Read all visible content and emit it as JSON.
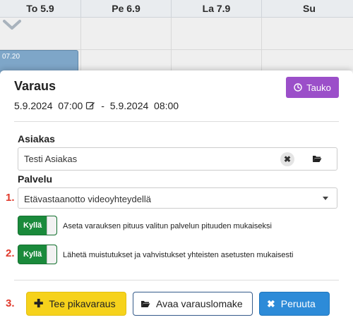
{
  "calendar": {
    "days": [
      "To 5.9",
      "Pe 6.9",
      "La 7.9",
      "Su"
    ],
    "event_time": "07.20"
  },
  "modal": {
    "title": "Varaus",
    "break_button": "Tauko",
    "start": "5.9.2024  07:00",
    "separator": " - ",
    "end": "5.9.2024  08:00",
    "customer_label": "Asiakas",
    "customer_value": "Testi Asiakas",
    "service_label": "Palvelu",
    "service_value": "Etävastaanotto videoyhteydellä",
    "step_numbers": [
      "1.",
      "2.",
      "3."
    ],
    "toggle1": {
      "label": "Kyllä",
      "text": "Aseta varauksen pituus valitun palvelun pituuden mukaiseksi",
      "on": true
    },
    "toggle2": {
      "label": "Kyllä",
      "text": "Lähetä muistutukset ja vahvistukset yhteisten asetusten mukaisesti",
      "on": true
    },
    "buttons": {
      "quick": "Tee pikavaraus",
      "open_form": "Avaa varauslomake",
      "cancel": "Peruuta"
    }
  },
  "colors": {
    "purple": "#9b4fc9",
    "green": "#1a8a3b",
    "yellow": "#f6d21b",
    "blue": "#2d8bd8",
    "step_red": "#e0392b",
    "event": "#7ea6c8"
  }
}
